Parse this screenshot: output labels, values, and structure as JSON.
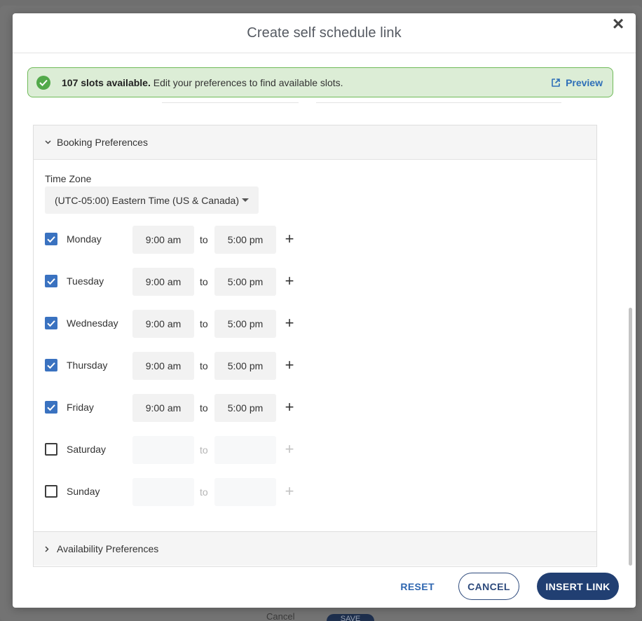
{
  "background": {
    "footer_cancel": "Cancel",
    "footer_save": "SAVE"
  },
  "modal": {
    "title": "Create self schedule link",
    "close_glyph": "×"
  },
  "banner": {
    "count_text": "107 slots available.",
    "message": "Edit your preferences to find available slots.",
    "preview_label": "Preview",
    "success_color": "#52a94a"
  },
  "booking": {
    "header": "Booking Preferences",
    "timezone_label": "Time Zone",
    "timezone_value": "(UTC-05:00) Eastern Time (US & Canada)",
    "to_label": "to",
    "days": [
      {
        "name": "Monday",
        "checked": true,
        "from": "9:00 am",
        "to": "5:00 pm"
      },
      {
        "name": "Tuesday",
        "checked": true,
        "from": "9:00 am",
        "to": "5:00 pm"
      },
      {
        "name": "Wednesday",
        "checked": true,
        "from": "9:00 am",
        "to": "5:00 pm"
      },
      {
        "name": "Thursday",
        "checked": true,
        "from": "9:00 am",
        "to": "5:00 pm"
      },
      {
        "name": "Friday",
        "checked": true,
        "from": "9:00 am",
        "to": "5:00 pm"
      },
      {
        "name": "Saturday",
        "checked": false,
        "from": "",
        "to": ""
      },
      {
        "name": "Sunday",
        "checked": false,
        "from": "",
        "to": ""
      }
    ]
  },
  "availability": {
    "header": "Availability Preferences"
  },
  "footer": {
    "reset_label": "RESET",
    "cancel_label": "CANCEL",
    "insert_label": "INSERT LINK",
    "primary_color": "#213f72"
  }
}
